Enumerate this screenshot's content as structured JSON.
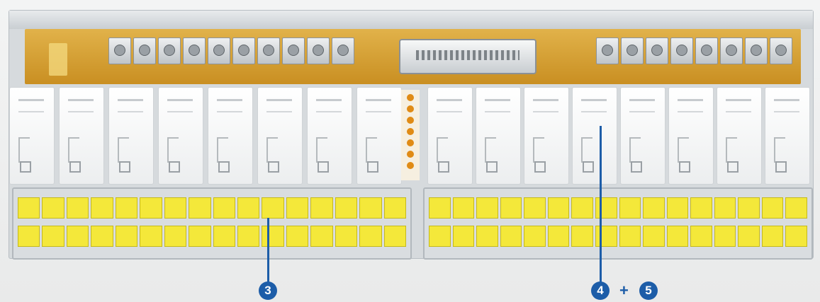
{
  "callouts": {
    "left": "3",
    "right_a": "4",
    "plus": "+",
    "right_b": "5"
  },
  "colors": {
    "callout": "#1d5da8",
    "terminal": "#f4e83a",
    "pcb": "#d9a238"
  }
}
